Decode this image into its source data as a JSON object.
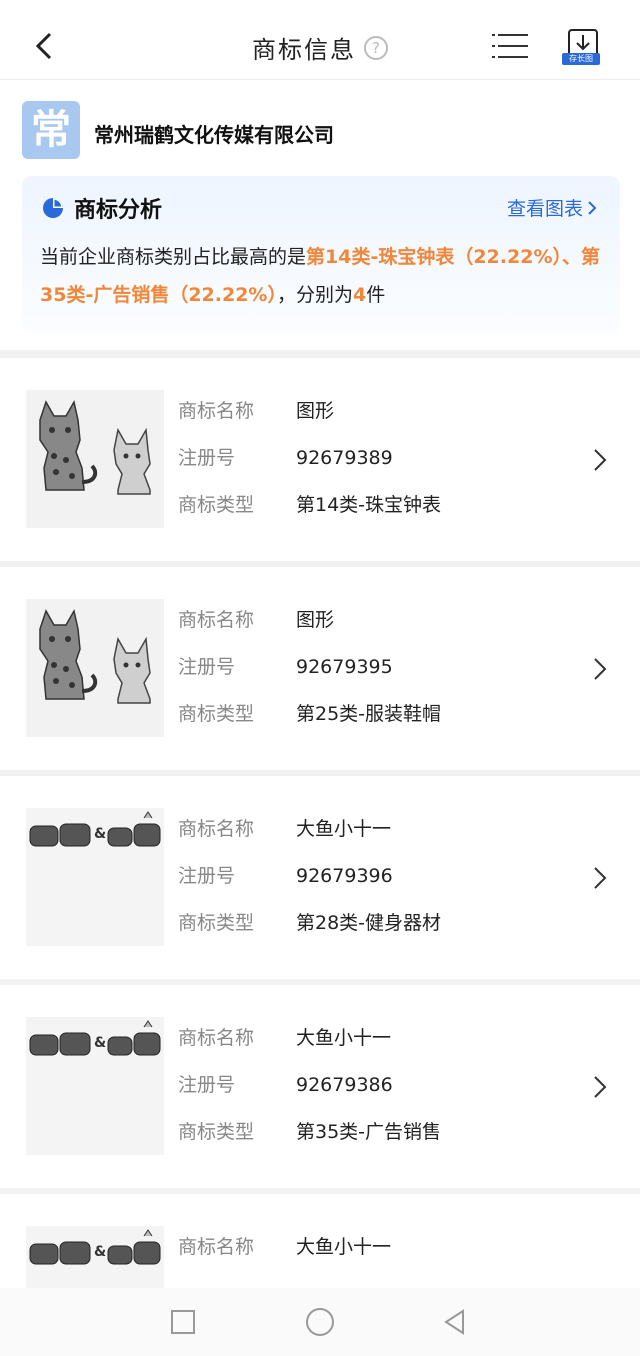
{
  "header": {
    "title": "商标信息",
    "help_glyph": "?",
    "save_label": "存长图"
  },
  "company": {
    "logo_char": "常",
    "name": "常州瑞鹤文化传媒有限公司"
  },
  "analysis": {
    "title": "商标分析",
    "chart_link": "查看图表",
    "text_prefix": "当前企业商标类别占比最高的是",
    "highlight1": "第14类-珠宝钟表（22.22%）、第35类-广告销售（22.22%）",
    "text_middle": "，分别为",
    "count": "4",
    "text_suffix": "件"
  },
  "labels": {
    "name": "商标名称",
    "reg_no": "注册号",
    "type": "商标类型"
  },
  "items": [
    {
      "name": "图形",
      "reg_no": "92679389",
      "type": "第14类-珠宝钟表",
      "image": "cat-trademark-icon"
    },
    {
      "name": "图形",
      "reg_no": "92679395",
      "type": "第25类-服装鞋帽",
      "image": "cat-trademark-icon"
    },
    {
      "name": "大鱼小十一",
      "reg_no": "92679396",
      "type": "第28类-健身器材",
      "image": "text-trademark-icon"
    },
    {
      "name": "大鱼小十一",
      "reg_no": "92679386",
      "type": "第35类-广告销售",
      "image": "text-trademark-icon"
    },
    {
      "name": "大鱼小十一",
      "reg_no": "",
      "type": "",
      "image": "text-trademark-icon"
    }
  ],
  "colors": {
    "accent_blue": "#2a6ad8",
    "highlight_orange": "#f0873a"
  }
}
